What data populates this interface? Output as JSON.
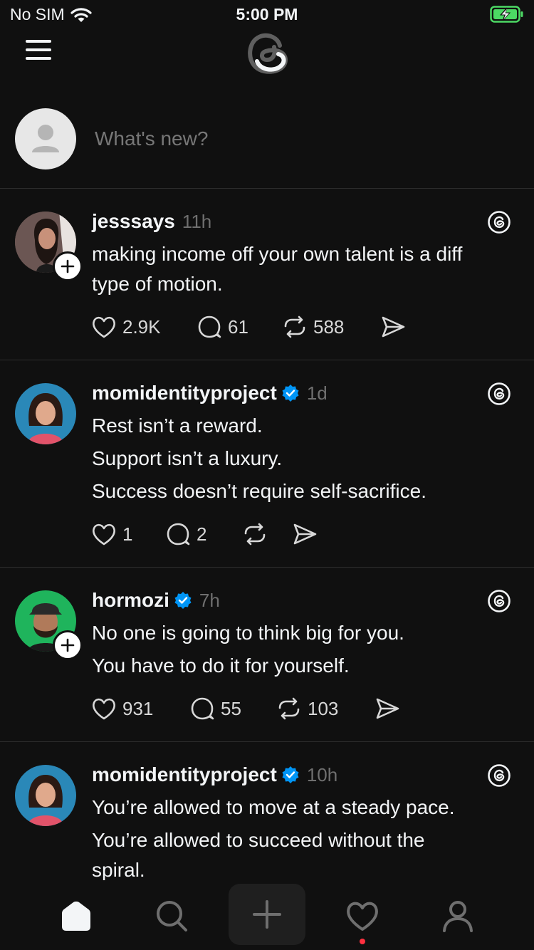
{
  "status_bar": {
    "carrier": "No SIM",
    "time": "5:00 PM"
  },
  "composer": {
    "placeholder": "What's new?"
  },
  "posts": [
    {
      "username": "jesssays",
      "time": "11h",
      "verified": false,
      "lines": [
        "making income off your own talent is a diff",
        "type of motion."
      ],
      "likes": "2.9K",
      "replies": "61",
      "reposts": "588"
    },
    {
      "username": "momidentityproject",
      "time": "1d",
      "verified": true,
      "lines": [
        "Rest isn’t a reward.",
        "Support isn’t a luxury.",
        "Success doesn’t require self-sacrifice."
      ],
      "likes": "1",
      "replies": "2",
      "reposts": ""
    },
    {
      "username": "hormozi",
      "time": "7h",
      "verified": true,
      "lines": [
        "No one is going to think big for you.",
        "You have to do it for yourself."
      ],
      "likes": "931",
      "replies": "55",
      "reposts": "103"
    },
    {
      "username": "momidentityproject",
      "time": "10h",
      "verified": true,
      "lines": [
        "You’re allowed to move at a steady pace.",
        "You’re allowed to succeed without the",
        "spiral."
      ]
    }
  ],
  "tab_bar": {
    "items": [
      "home-icon",
      "search-icon",
      "create-icon",
      "activity-icon",
      "profile-icon"
    ]
  },
  "colors": {
    "background": "#101010",
    "verified": "#0095f6",
    "notification_dot": "#ff3040"
  }
}
